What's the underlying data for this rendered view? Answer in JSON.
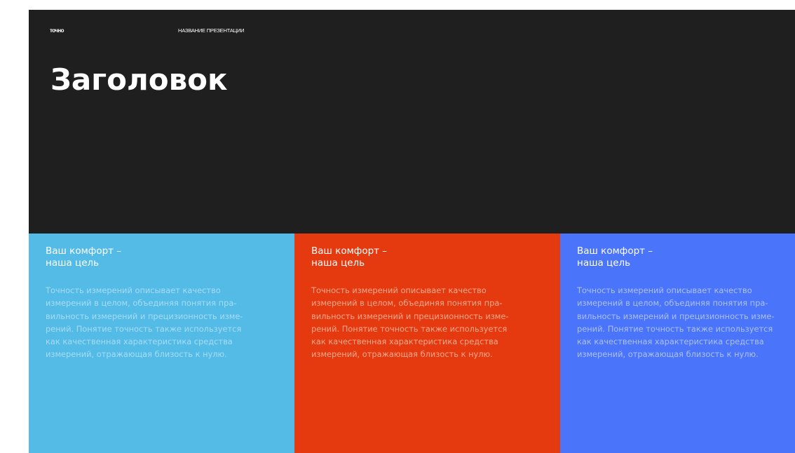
{
  "header": {
    "logo": "точно",
    "presentation_name": "НАЗВАНИЕ ПРЕЗЕНТАЦИИ",
    "title": "Заголовок"
  },
  "cards": [
    {
      "heading": "Ваш комфорт –\nнаша цель",
      "body": "Точность измерений описывает качество\nизмерений в целом, объединяя понятия пра-\nвильность измерений и прецизионность изме-\nрений. Понятие точность также используется\nкак качественная характеристика средства\nизмерений, отражающая близость к нулю.",
      "background": "#54bbe7",
      "text_color": "#a6dcf5"
    },
    {
      "heading": "Ваш комфорт –\nнаша цель",
      "body": "Точность измерений описывает качество\nизмерений в целом, объединяя понятия пра-\nвильность измерений и прецизионность изме-\nрений. Понятие точность также используется\nкак качественная характеристика средства\nизмерений, отражающая близость к нулю.",
      "background": "#e53a10",
      "text_color": "#f5a98e"
    },
    {
      "heading": "Ваш комфорт –\nнаша цель",
      "body": "Точность измерений описывает качество\nизмерений в целом, объединяя понятия пра-\nвильность измерений и прецизионность изме-\nрений. Понятие точность также используется\nкак качественная характеристика средства\nизмерений, отражающая близость к нулю.",
      "background": "#4a74fa",
      "text_color": "#acc0fd"
    }
  ]
}
